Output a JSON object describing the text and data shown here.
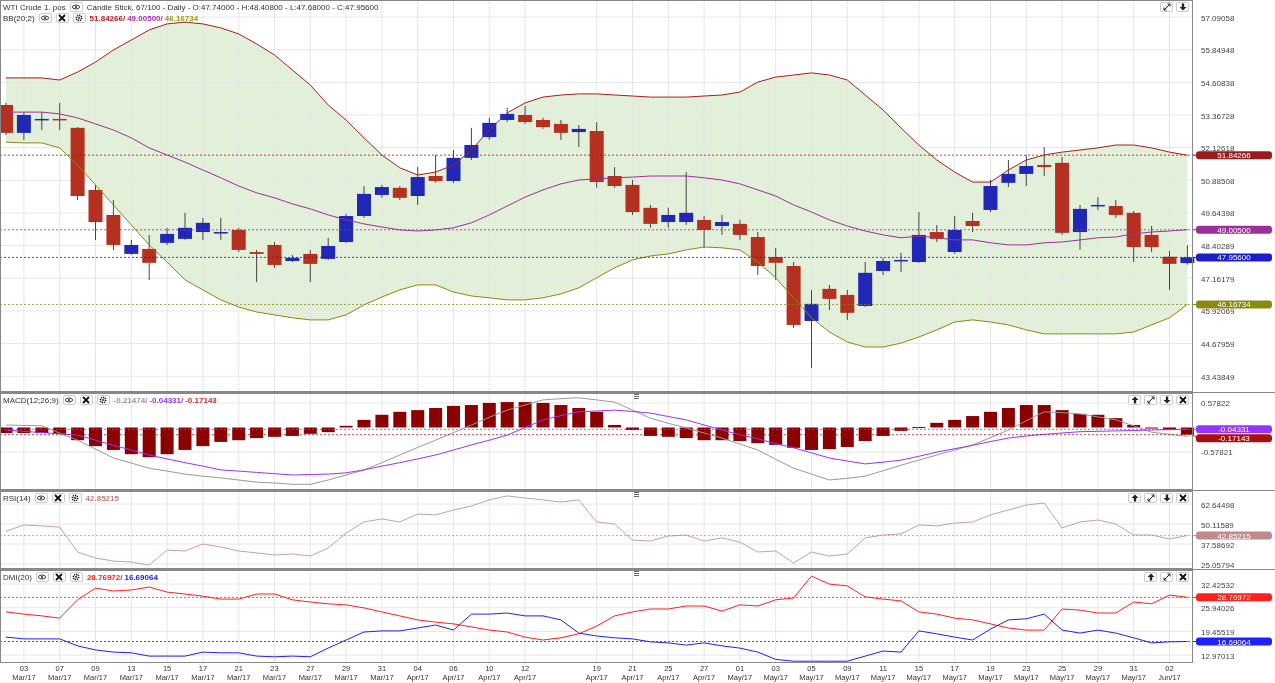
{
  "panels": [
    {
      "kind": "price",
      "header_rows": [
        {
          "label": "WTI Crude 1. pos",
          "buttons": [
            {
              "kind": "eye"
            }
          ],
          "text": "Candle Stick, 67/100 - Daily - O:47.74000 - H:48.40800 - L:47.68000 - C:47.95600"
        },
        {
          "label": "BB(20;2)",
          "buttons": [
            {
              "kind": "eye"
            },
            {
              "kind": "close"
            },
            {
              "kind": "settings"
            }
          ],
          "values": [
            {
              "text": "51.84266/",
              "color": "#c42020"
            },
            {
              "text": "49.00500/",
              "color": "#b030b0"
            },
            {
              "text": "46.16734",
              "color": "#9a9a10"
            }
          ]
        }
      ],
      "controls": [
        {
          "kind": "expand"
        },
        {
          "kind": "down"
        }
      ],
      "chart_data": {
        "type": "candlestick",
        "grid": true,
        "ylim": [
          42.84,
          57.74
        ],
        "yticks": [
          {
            "value": 57.09058,
            "label": "57.09058"
          },
          {
            "value": 55.84948,
            "label": "55.84948"
          },
          {
            "value": 54.60838,
            "label": "54.60838"
          },
          {
            "value": 53.36728,
            "label": "53.36728"
          },
          {
            "value": 52.12618,
            "label": "52.12618"
          },
          {
            "value": 50.88508,
            "label": "50.88508"
          },
          {
            "value": 49.64398,
            "label": "49.64398"
          },
          {
            "value": 48.40289,
            "label": "48.40289"
          },
          {
            "value": 47.16179,
            "label": "47.16179"
          },
          {
            "value": 45.92069,
            "label": "45.92069"
          },
          {
            "value": 44.67959,
            "label": "44.67959"
          },
          {
            "value": 43.43849,
            "label": "43.43849"
          }
        ],
        "ohlc": [
          [
            53.75,
            53.83,
            52.61,
            52.69
          ],
          [
            52.69,
            53.48,
            52.42,
            53.37
          ],
          [
            53.18,
            53.48,
            52.8,
            53.22
          ],
          [
            53.22,
            53.83,
            52.8,
            53.18
          ],
          [
            52.88,
            52.91,
            50.14,
            50.29
          ],
          [
            50.52,
            50.71,
            48.62,
            49.3
          ],
          [
            49.57,
            50.14,
            48.24,
            48.43
          ],
          [
            48.09,
            48.62,
            48.05,
            48.43
          ],
          [
            48.28,
            48.81,
            47.1,
            47.75
          ],
          [
            48.51,
            49.08,
            48.43,
            48.85
          ],
          [
            48.66,
            49.65,
            48.62,
            49.08
          ],
          [
            48.92,
            49.46,
            48.62,
            49.27
          ],
          [
            48.89,
            49.46,
            48.62,
            48.92
          ],
          [
            49.0,
            49.08,
            48.16,
            48.24
          ],
          [
            48.16,
            48.24,
            47.02,
            48.09
          ],
          [
            48.43,
            48.54,
            47.56,
            47.67
          ],
          [
            47.82,
            48.05,
            47.78,
            47.94
          ],
          [
            48.09,
            48.24,
            47.02,
            47.71
          ],
          [
            47.9,
            48.7,
            47.86,
            48.39
          ],
          [
            48.54,
            49.61,
            48.51,
            49.53
          ],
          [
            49.53,
            50.67,
            49.46,
            50.37
          ],
          [
            50.33,
            50.71,
            50.22,
            50.63
          ],
          [
            50.6,
            50.67,
            50.14,
            50.22
          ],
          [
            50.29,
            51.39,
            49.95,
            51.01
          ],
          [
            51.05,
            51.85,
            50.8,
            50.86
          ],
          [
            50.86,
            52.04,
            50.79,
            51.74
          ],
          [
            51.74,
            52.88,
            51.66,
            52.23
          ],
          [
            52.53,
            53.26,
            52.42,
            53.07
          ],
          [
            53.18,
            53.64,
            53.1,
            53.41
          ],
          [
            53.37,
            53.71,
            53.03,
            53.1
          ],
          [
            53.18,
            53.26,
            52.84,
            52.91
          ],
          [
            53.03,
            53.18,
            52.42,
            52.69
          ],
          [
            52.72,
            52.99,
            52.15,
            52.84
          ],
          [
            52.76,
            53.1,
            50.6,
            50.82
          ],
          [
            51.05,
            51.39,
            50.6,
            50.67
          ],
          [
            50.71,
            50.9,
            49.57,
            49.68
          ],
          [
            49.84,
            49.95,
            49.08,
            49.23
          ],
          [
            49.3,
            49.84,
            49.08,
            49.57
          ],
          [
            49.3,
            51.2,
            49.19,
            49.65
          ],
          [
            49.38,
            49.53,
            48.32,
            49.0
          ],
          [
            49.15,
            49.57,
            48.81,
            49.3
          ],
          [
            49.23,
            49.38,
            48.62,
            48.81
          ],
          [
            48.73,
            48.92,
            47.29,
            47.63
          ],
          [
            47.97,
            48.32,
            47.1,
            47.75
          ],
          [
            47.63,
            47.78,
            45.28,
            45.39
          ],
          [
            45.54,
            46.72,
            43.76,
            46.19
          ],
          [
            46.76,
            46.91,
            45.96,
            46.38
          ],
          [
            46.53,
            46.72,
            45.58,
            45.85
          ],
          [
            46.11,
            47.78,
            46.07,
            47.37
          ],
          [
            47.44,
            47.94,
            47.29,
            47.82
          ],
          [
            47.82,
            48.13,
            47.4,
            47.86
          ],
          [
            47.78,
            49.68,
            47.75,
            48.81
          ],
          [
            48.92,
            49.19,
            48.54,
            48.66
          ],
          [
            48.16,
            49.53,
            48.09,
            49.0
          ],
          [
            49.34,
            49.65,
            48.92,
            49.15
          ],
          [
            49.76,
            50.9,
            49.68,
            50.67
          ],
          [
            50.79,
            51.66,
            50.63,
            51.13
          ],
          [
            51.13,
            51.85,
            50.67,
            51.43
          ],
          [
            51.47,
            52.15,
            51.05,
            51.39
          ],
          [
            51.55,
            51.77,
            48.81,
            48.89
          ],
          [
            48.92,
            49.95,
            48.24,
            49.8
          ],
          [
            49.91,
            50.25,
            49.76,
            49.95
          ],
          [
            49.91,
            50.14,
            49.46,
            49.57
          ],
          [
            49.65,
            49.72,
            47.78,
            48.35
          ],
          [
            48.81,
            49.15,
            48.16,
            48.35
          ],
          [
            47.98,
            48.2,
            46.72,
            47.71
          ],
          [
            47.74,
            48.41,
            47.68,
            47.96
          ]
        ],
        "series": [
          {
            "type": "line",
            "color": "#a32020",
            "values": [
              54.78,
              54.78,
              54.78,
              54.7,
              55.0,
              55.38,
              55.84,
              56.22,
              56.6,
              56.83,
              56.9,
              56.83,
              56.68,
              56.45,
              56.07,
              55.65,
              55.08,
              54.51,
              53.75,
              53.18,
              52.5,
              51.85,
              51.36,
              51.09,
              51.2,
              51.47,
              52.04,
              52.8,
              53.45,
              53.83,
              54.05,
              54.13,
              54.17,
              54.17,
              54.13,
              54.09,
              54.05,
              54.05,
              54.05,
              54.09,
              54.13,
              54.24,
              54.62,
              54.81,
              54.89,
              54.97,
              54.89,
              54.7,
              54.13,
              53.56,
              52.88,
              52.23,
              51.66,
              51.2,
              50.82,
              50.82,
              51.28,
              51.66,
              51.85,
              51.96,
              52.04,
              52.12,
              52.23,
              52.23,
              52.12,
              51.96,
              51.84
            ]
          },
          {
            "type": "line",
            "color": "#9b309b",
            "values": [
              53.48,
              53.48,
              53.48,
              53.41,
              53.26,
              53.03,
              52.8,
              52.5,
              52.12,
              51.85,
              51.58,
              51.28,
              50.98,
              50.67,
              50.41,
              50.22,
              49.99,
              49.8,
              49.57,
              49.38,
              49.23,
              49.11,
              49.0,
              48.96,
              49.0,
              49.08,
              49.27,
              49.57,
              49.91,
              50.25,
              50.52,
              50.75,
              50.9,
              50.94,
              50.98,
              51.01,
              51.05,
              51.05,
              51.05,
              50.98,
              50.9,
              50.75,
              50.52,
              50.29,
              49.95,
              49.68,
              49.38,
              49.15,
              48.96,
              48.81,
              48.7,
              48.77,
              48.7,
              48.62,
              48.62,
              48.51,
              48.43,
              48.43,
              48.51,
              48.54,
              48.62,
              48.7,
              48.73,
              48.85,
              48.92,
              48.96,
              49.01
            ]
          },
          {
            "type": "line",
            "color": "#8a8a10",
            "values": [
              52.34,
              52.31,
              52.31,
              52.12,
              51.47,
              50.71,
              49.95,
              49.19,
              48.43,
              47.78,
              47.1,
              46.72,
              46.34,
              46.07,
              45.88,
              45.77,
              45.66,
              45.58,
              45.58,
              45.77,
              46.15,
              46.45,
              46.72,
              46.91,
              46.91,
              46.64,
              46.49,
              46.42,
              46.34,
              46.34,
              46.42,
              46.57,
              46.8,
              47.18,
              47.56,
              47.86,
              48.01,
              48.09,
              48.24,
              48.35,
              48.32,
              48.24,
              47.78,
              47.18,
              46.42,
              45.66,
              45.12,
              44.74,
              44.55,
              44.55,
              44.7,
              44.93,
              45.2,
              45.5,
              45.58,
              45.5,
              45.39,
              45.2,
              45.05,
              45.05,
              45.05,
              45.05,
              45.05,
              45.12,
              45.39,
              45.66,
              46.17
            ]
          }
        ],
        "ref_lines": [
          {
            "axis": "y",
            "value": 51.84266,
            "label": "51.84266",
            "color": "#9b1c1c"
          },
          {
            "axis": "y",
            "value": 49.005,
            "label": "49.00500",
            "color": "#9b309b"
          },
          {
            "axis": "y",
            "value": 47.956,
            "label": "47.95600",
            "color": "#1c1cc8"
          },
          {
            "axis": "y",
            "value": 46.16734,
            "label": "46.16734",
            "color": "#8a8a10"
          }
        ]
      }
    },
    {
      "kind": "macd",
      "header_rows": [
        {
          "label": "MACD(12;26;9)",
          "buttons": [
            {
              "kind": "eye"
            },
            {
              "kind": "close"
            },
            {
              "kind": "settings"
            }
          ],
          "values": [
            {
              "text": "-0.21474/",
              "color": "#999999"
            },
            {
              "text": "-0.04331/",
              "color": "#9933ff"
            },
            {
              "text": "-0.17143",
              "color": "#d42a2a"
            }
          ]
        }
      ],
      "controls": [
        {
          "kind": "up"
        },
        {
          "kind": "expand"
        },
        {
          "kind": "down"
        },
        {
          "kind": "close"
        }
      ],
      "chart_data": {
        "type": "bar",
        "grid": true,
        "ylim": [
          -1.475,
          0.814
        ],
        "yticks": [
          {
            "value": 0.57822,
            "label": "0.57822"
          },
          {
            "value": -0.57821,
            "label": "-0.57821"
          }
        ],
        "series": [
          {
            "type": "bar",
            "color": "#8b0000",
            "values": [
              -0.13,
              -0.13,
              -0.13,
              -0.15,
              -0.3,
              -0.44,
              -0.53,
              -0.63,
              -0.7,
              -0.63,
              -0.53,
              -0.44,
              -0.34,
              -0.3,
              -0.25,
              -0.22,
              -0.2,
              -0.15,
              -0.11,
              0.04,
              0.18,
              0.3,
              0.37,
              0.41,
              0.46,
              0.51,
              0.53,
              0.58,
              0.6,
              0.6,
              0.58,
              0.53,
              0.46,
              0.37,
              0.06,
              -0.06,
              -0.2,
              -0.22,
              -0.25,
              -0.3,
              -0.3,
              -0.32,
              -0.37,
              -0.41,
              -0.48,
              -0.53,
              -0.51,
              -0.46,
              -0.32,
              -0.2,
              -0.08,
              0.01,
              0.11,
              0.18,
              0.27,
              0.37,
              0.46,
              0.53,
              0.53,
              0.41,
              0.32,
              0.3,
              0.22,
              0.06,
              -0.01,
              -0.06,
              -0.17
            ]
          },
          {
            "type": "line",
            "color": "#999999",
            "values": [
              0.06,
              0.05,
              0.04,
              -0.13,
              -0.3,
              -0.51,
              -0.72,
              -0.84,
              -0.96,
              -1.03,
              -1.1,
              -1.15,
              -1.19,
              -1.24,
              -1.29,
              -1.31,
              -1.34,
              -1.34,
              -1.24,
              -1.12,
              -1.0,
              -0.83,
              -0.65,
              -0.47,
              -0.3,
              -0.12,
              0.06,
              0.24,
              0.41,
              0.53,
              0.65,
              0.68,
              0.7,
              0.65,
              0.6,
              0.41,
              0.22,
              0.1,
              -0.01,
              -0.13,
              -0.25,
              -0.39,
              -0.53,
              -0.75,
              -0.96,
              -1.1,
              -1.24,
              -1.2,
              -1.15,
              -1.02,
              -0.89,
              -0.77,
              -0.65,
              -0.53,
              -0.41,
              -0.24,
              -0.06,
              0.16,
              0.37,
              0.35,
              0.32,
              0.25,
              0.18,
              0.04,
              -0.11,
              -0.16,
              -0.21
            ]
          },
          {
            "type": "line",
            "color": "#9933ff",
            "values": [
              -0.06,
              -0.09,
              -0.12,
              -0.15,
              -0.18,
              -0.3,
              -0.42,
              -0.53,
              -0.65,
              -0.74,
              -0.83,
              -0.91,
              -1.0,
              -1.03,
              -1.06,
              -1.09,
              -1.12,
              -1.11,
              -1.1,
              -1.07,
              -1.0,
              -0.91,
              -0.83,
              -0.74,
              -0.65,
              -0.53,
              -0.41,
              -0.3,
              -0.18,
              0.0,
              0.18,
              0.28,
              0.37,
              0.39,
              0.41,
              0.38,
              0.34,
              0.26,
              0.18,
              0.06,
              -0.06,
              -0.17,
              -0.27,
              -0.38,
              -0.48,
              -0.6,
              -0.72,
              -0.79,
              -0.86,
              -0.82,
              -0.77,
              -0.68,
              -0.58,
              -0.5,
              -0.42,
              -0.33,
              -0.25,
              -0.2,
              -0.16,
              -0.13,
              -0.1,
              -0.09,
              -0.08,
              -0.07,
              -0.06,
              -0.05,
              -0.04
            ]
          }
        ],
        "ref_lines": [
          {
            "axis": "y",
            "value": -0.04331,
            "label": "-0.04331",
            "color": "#9933ff"
          },
          {
            "axis": "y",
            "value": -0.17143,
            "label": "-0.17143",
            "color": "#a81010"
          }
        ]
      }
    },
    {
      "kind": "rsi",
      "header_rows": [
        {
          "label": "RSI(14)",
          "buttons": [
            {
              "kind": "eye"
            },
            {
              "kind": "close"
            },
            {
              "kind": "settings"
            }
          ],
          "values": [
            {
              "text": "42.85215",
              "color": "#c08080"
            }
          ]
        }
      ],
      "controls": [
        {
          "kind": "up"
        },
        {
          "kind": "expand"
        },
        {
          "kind": "down"
        },
        {
          "kind": "close"
        }
      ],
      "chart_data": {
        "type": "line",
        "grid": true,
        "ylim": [
          21.93,
          70.79
        ],
        "yticks": [
          {
            "value": 62.64498,
            "label": "62.64498"
          },
          {
            "value": 50.11589,
            "label": "50.11589"
          },
          {
            "value": 37.58692,
            "label": "37.58692"
          },
          {
            "value": 25.05794,
            "label": "25.05794"
          }
        ],
        "series": [
          {
            "color": "#c9a0a0",
            "values": [
              45.7,
              49.5,
              48.9,
              48.2,
              32.6,
              28.8,
              26.9,
              26.3,
              24.4,
              33.8,
              33.2,
              37.6,
              35.7,
              33.2,
              32.0,
              30.7,
              31.3,
              30.1,
              35.1,
              44.5,
              51.4,
              53.3,
              51.4,
              56.4,
              55.8,
              58.9,
              61.4,
              65.2,
              67.7,
              66.4,
              65.2,
              63.9,
              65.2,
              51.4,
              50.1,
              40.1,
              39.5,
              42.6,
              43.2,
              39.5,
              41.4,
              38.8,
              32.6,
              33.2,
              25.7,
              32.6,
              30.1,
              31.3,
              41.4,
              43.2,
              43.9,
              49.5,
              48.9,
              50.7,
              51.4,
              55.8,
              58.9,
              62.0,
              63.3,
              47.6,
              51.4,
              52.6,
              50.1,
              43.2,
              43.2,
              40.7,
              42.9
            ]
          }
        ],
        "ref_lines": [
          {
            "axis": "y",
            "value": 42.85215,
            "label": "42.85215",
            "color": "#c08a8a"
          }
        ]
      }
    },
    {
      "kind": "dmi",
      "header_rows": [
        {
          "label": "DMI(20)",
          "buttons": [
            {
              "kind": "eye"
            },
            {
              "kind": "close"
            },
            {
              "kind": "settings"
            }
          ],
          "values": [
            {
              "text": "28.76972/",
              "color": "#ff2020"
            },
            {
              "text": "16.69064",
              "color": "#2020ff"
            }
          ]
        }
      ],
      "controls": [
        {
          "kind": "up"
        },
        {
          "kind": "expand"
        },
        {
          "kind": "close"
        }
      ],
      "chart_data": {
        "type": "line",
        "grid": true,
        "categories": [
          null,
          "03 Mar/17",
          null,
          "07 Mar/17",
          null,
          "09 Mar/17",
          null,
          "13 Mar/17",
          null,
          "15 Mar/17",
          null,
          "17 Mar/17",
          null,
          "21 Mar/17",
          null,
          "23 Mar/17",
          null,
          "27 Mar/17",
          null,
          "29 Mar/17",
          null,
          "31 Mar/17",
          null,
          "04 Apr/17",
          null,
          "06 Apr/17",
          null,
          "10 Apr/17",
          null,
          "12 Apr/17",
          null,
          null,
          null,
          "19 Apr/17",
          null,
          "21 Apr/17",
          null,
          "25 Apr/17",
          null,
          "27 Apr/17",
          null,
          "01 May/17",
          null,
          "03 May/17",
          null,
          "05 May/17",
          null,
          "09 May/17",
          null,
          "11 May/17",
          null,
          "15 May/17",
          null,
          "17 May/17",
          null,
          "19 May/17",
          null,
          "23 May/17",
          null,
          "25 May/17",
          null,
          "29 May/17",
          null,
          "31 May/17",
          null,
          "02 Jun/17",
          null
        ],
        "ylim": [
          10.81,
          36.26
        ],
        "yticks": [
          {
            "value": 32.42532,
            "label": "32.42532"
          },
          {
            "value": 25.94026,
            "label": "25.94026"
          },
          {
            "value": 19.45519,
            "label": "19.45519"
          },
          {
            "value": 12.97013,
            "label": "12.97013"
          }
        ],
        "series": [
          {
            "color": "#ff2020",
            "values": [
              24.8,
              24.2,
              23.7,
              23.1,
              28.1,
              31.3,
              30.5,
              30.8,
              31.6,
              30.2,
              29.7,
              29.1,
              28.3,
              28.3,
              29.7,
              29.7,
              28.1,
              27.5,
              27.0,
              26.7,
              25.9,
              24.8,
              23.7,
              22.6,
              22.0,
              21.5,
              20.7,
              19.8,
              19.3,
              17.9,
              17.1,
              17.7,
              18.8,
              20.9,
              23.7,
              24.8,
              25.6,
              25.6,
              26.4,
              26.4,
              25.0,
              26.7,
              26.4,
              28.1,
              28.6,
              34.6,
              32.4,
              31.9,
              28.9,
              28.3,
              27.8,
              24.8,
              24.2,
              23.1,
              22.6,
              21.5,
              20.4,
              19.8,
              19.8,
              25.6,
              25.3,
              24.5,
              24.5,
              27.5,
              27.0,
              29.4,
              28.8
            ]
          },
          {
            "color": "#2020ff",
            "values": [
              17.9,
              17.4,
              17.4,
              17.4,
              15.5,
              14.4,
              13.8,
              13.6,
              12.7,
              12.7,
              12.7,
              13.8,
              13.6,
              13.6,
              12.7,
              12.5,
              12.7,
              12.5,
              14.9,
              17.1,
              19.3,
              19.6,
              19.6,
              20.4,
              21.2,
              19.8,
              24.2,
              24.2,
              24.5,
              23.7,
              23.7,
              22.6,
              19.0,
              18.2,
              17.7,
              17.4,
              16.6,
              16.3,
              15.7,
              16.3,
              15.5,
              14.9,
              13.8,
              11.8,
              11.3,
              11.3,
              11.3,
              11.3,
              12.7,
              14.1,
              13.8,
              19.6,
              18.8,
              17.9,
              17.1,
              20.1,
              22.6,
              22.9,
              24.2,
              19.8,
              19.0,
              19.8,
              19.0,
              17.7,
              16.3,
              16.6,
              16.7
            ]
          }
        ],
        "ref_lines": [
          {
            "axis": "y",
            "value": 28.76972,
            "label": "28.76972",
            "color": "#ff2020"
          },
          {
            "axis": "y",
            "value": 16.69064,
            "label": "16.69064",
            "color": "#2020ff"
          }
        ]
      }
    }
  ]
}
